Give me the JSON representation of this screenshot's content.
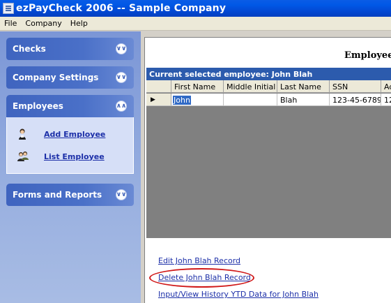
{
  "window": {
    "title": "ezPayCheck 2006 -- Sample Company"
  },
  "menu": [
    "File",
    "Company",
    "Help"
  ],
  "sidebar": {
    "groups": [
      {
        "label": "Checks",
        "chevron": "double-chevron-down-icon"
      },
      {
        "label": "Company Settings",
        "chevron": "double-chevron-down-icon"
      },
      {
        "label": "Employees",
        "chevron": "double-chevron-up-icon"
      },
      {
        "label": "Forms and Reports",
        "chevron": "double-chevron-down-icon"
      }
    ],
    "employee_tasks": [
      {
        "label": "Add Employee",
        "icon": "add-person-icon"
      },
      {
        "label": "List Employee",
        "icon": "people-list-icon"
      }
    ]
  },
  "panel": {
    "title": "Employee",
    "grid_caption": "Current selected employee: John Blah",
    "columns": [
      "First Name",
      "Middle Initial",
      "Last Name",
      "SSN",
      "Ad"
    ],
    "rows": [
      {
        "first": "John",
        "middle": "",
        "last": "Blah",
        "ssn": "123-45-6789",
        "extra": "12"
      }
    ],
    "actions": [
      "Edit John Blah Record",
      "Delete John Blah Record",
      "Input/View History YTD Data for John Blah"
    ]
  },
  "colors": {
    "titlebar": "#0058e6",
    "caption_bar": "#2c5bad",
    "highlight_ellipse": "#d01818",
    "link": "#1c2fa8"
  }
}
